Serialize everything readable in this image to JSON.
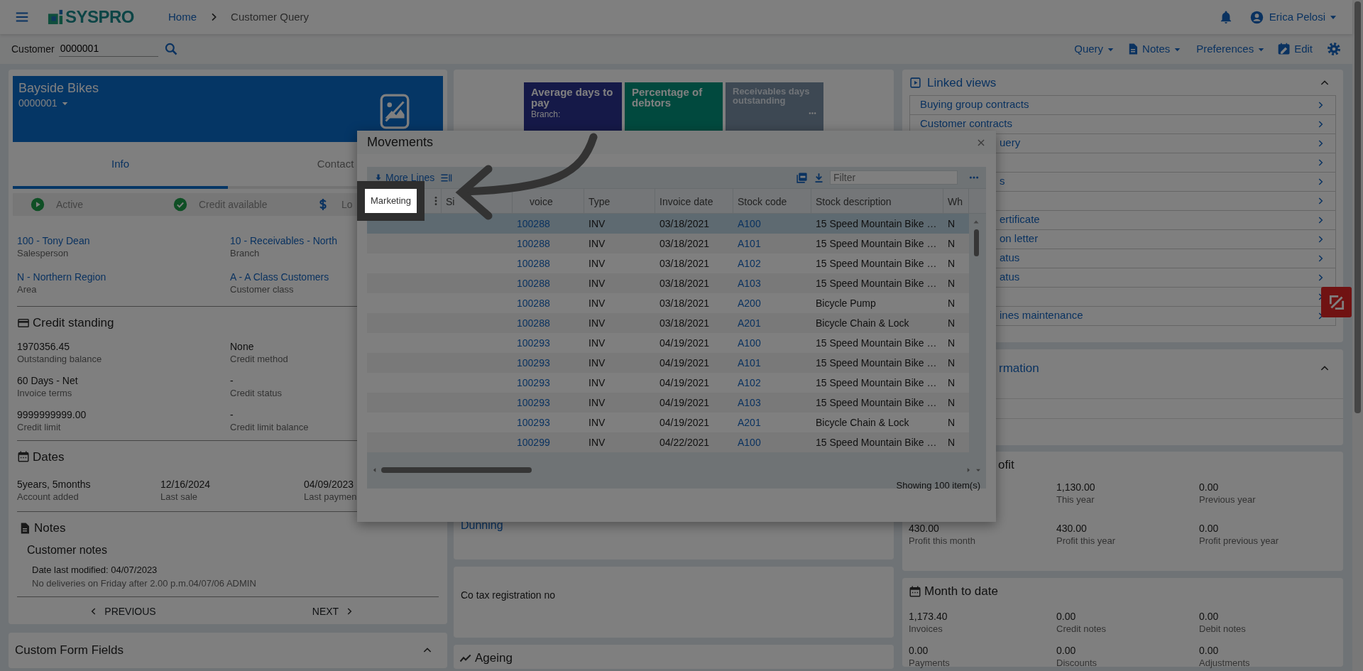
{
  "topbar": {
    "logo": "SYSPRO",
    "breadcrumbs": [
      {
        "label": "Home",
        "kind": "link"
      },
      {
        "label": "Customer Query",
        "kind": "current"
      }
    ],
    "user": "Erica Pelosi"
  },
  "customer_field": {
    "label": "Customer",
    "value": "0000001"
  },
  "actions": [
    {
      "label": "Query",
      "kind": "menu"
    },
    {
      "label": "Notes",
      "kind": "notes"
    },
    {
      "label": "Preferences",
      "kind": "menu"
    },
    {
      "label": "Edit",
      "kind": "edit"
    }
  ],
  "customer": {
    "name": "Bayside Bikes",
    "code": "0000001",
    "tabs": [
      {
        "label": "Info",
        "selected": true
      },
      {
        "label": "Contact",
        "selected": false
      }
    ],
    "status": [
      {
        "label": "Active",
        "kind": "active"
      },
      {
        "label": "Credit available",
        "kind": "credit"
      },
      {
        "label": "Lo",
        "kind": "money"
      }
    ],
    "links": [
      {
        "value": "100 - Tony Dean",
        "label": "Salesperson"
      },
      {
        "value": "10 - Receivables - North",
        "label": "Branch"
      },
      {
        "value": "N - Northern Region",
        "label": "Area"
      },
      {
        "value": "A - A Class Customers",
        "label": "Customer class"
      }
    ],
    "credit_standing": {
      "title": "Credit standing",
      "fields": [
        {
          "value": "1970356.45",
          "label": "Outstanding balance"
        },
        {
          "value": "None",
          "label": "Credit method"
        },
        {
          "value": "60 Days - Net",
          "label": "Invoice terms"
        },
        {
          "value": "-",
          "label": "Credit status"
        },
        {
          "value": "9999999999.00",
          "label": "Credit limit"
        },
        {
          "value": "-",
          "label": "Credit limit balance"
        }
      ]
    },
    "dates": {
      "title": "Dates",
      "fields": [
        {
          "value": "5years, 5months",
          "label": "Account added"
        },
        {
          "value": "12/16/2024",
          "label": "Last sale"
        },
        {
          "value": "04/09/2023",
          "label": "Last paymen"
        }
      ]
    },
    "notes": {
      "title": "Notes",
      "heading": "Customer notes",
      "modified": "Date last modified: 04/07/2023",
      "text": "No deliveries on Friday after 2.00 p.m.04/07/06 ADMIN"
    },
    "pager": {
      "previous": "PREVIOUS",
      "next": "NEXT"
    }
  },
  "custom_form_fields": {
    "title": "Custom Form Fields",
    "expanded": true
  },
  "kpis": [
    {
      "title": "Average days to pay",
      "subtitle": "Branch:",
      "kind": "navy",
      "more": false
    },
    {
      "title": "Percentage of debtors",
      "kind": "teal",
      "more": false
    },
    {
      "title": "Receivables days outstanding",
      "kind": "muted",
      "more": true
    }
  ],
  "dunning": "Dunning",
  "tax_registration": "Co tax registration no",
  "ageing": "Ageing",
  "linked_views": {
    "title": "Linked views",
    "expanded": true,
    "items": [
      {
        "kind": "link",
        "label": "Buying group contracts",
        "clipped": false
      },
      {
        "kind": "link",
        "label": "Customer contracts",
        "clipped": false
      },
      {
        "kind": "link",
        "label": "uery",
        "clipped": true
      },
      {
        "kind": "chevron-only"
      },
      {
        "kind": "link",
        "label": "s",
        "clipped": true
      },
      {
        "kind": "chevron-only"
      },
      {
        "kind": "link",
        "label": "ertificate",
        "clipped": true
      },
      {
        "kind": "link",
        "label": "on letter",
        "clipped": true
      },
      {
        "kind": "link",
        "label": "atus",
        "clipped": true
      },
      {
        "kind": "link",
        "label": "atus",
        "clipped": true
      },
      {
        "kind": "chevron-only"
      },
      {
        "kind": "link",
        "label": "ines maintenance",
        "clipped": true
      }
    ]
  },
  "customer_information": {
    "title": "rmation",
    "clipped": true,
    "expanded": true
  },
  "profit": {
    "title": "ofit",
    "clipped": true,
    "rows": [
      [
        null,
        {
          "value": "1,130.00",
          "label": "This year"
        },
        {
          "value": "0.00",
          "label": "Previous year"
        }
      ],
      [
        {
          "value": "430.00",
          "label": "Profit this month"
        },
        {
          "value": "430.00",
          "label": "Profit this year"
        },
        {
          "value": "0.00",
          "label": "Profit previous year"
        }
      ]
    ]
  },
  "month_to_date": {
    "title": "Month to date",
    "rows": [
      [
        {
          "value": "1,173.40",
          "label": "Invoices"
        },
        {
          "value": "0.00",
          "label": "Credit notes"
        },
        {
          "value": "0.00",
          "label": "Debit notes"
        }
      ],
      [
        {
          "value": "0.00",
          "label": "Payments"
        },
        {
          "value": "0.00",
          "label": "Discounts"
        },
        {
          "value": "0.00",
          "label": "Adjustments"
        }
      ]
    ]
  },
  "movements": {
    "title": "Movements",
    "more_lines": "More Lines",
    "filter_placeholder": "Filter",
    "columns": [
      {
        "label": "Marketing",
        "highlighted": true
      },
      {
        "label": "Si",
        "highlighted": false
      },
      {
        "label": "voice",
        "highlighted": false
      },
      {
        "label": "Type",
        "highlighted": false
      },
      {
        "label": "Invoice date",
        "highlighted": false
      },
      {
        "label": "Stock code",
        "highlighted": false
      },
      {
        "label": "Stock description",
        "highlighted": false
      },
      {
        "label": "Wh",
        "highlighted": false
      }
    ],
    "rows": [
      {
        "selected": true,
        "cells": [
          "",
          "",
          "100288",
          "INV",
          "03/18/2021",
          "A100",
          "15 Speed Mountain Bike …",
          "N"
        ]
      },
      {
        "selected": false,
        "cells": [
          "",
          "",
          "100288",
          "INV",
          "03/18/2021",
          "A101",
          "15 Speed Mountain Bike …",
          "N"
        ]
      },
      {
        "selected": false,
        "cells": [
          "",
          "",
          "100288",
          "INV",
          "03/18/2021",
          "A102",
          "15 Speed Mountain Bike …",
          "N"
        ]
      },
      {
        "selected": false,
        "cells": [
          "",
          "",
          "100288",
          "INV",
          "03/18/2021",
          "A103",
          "15 Speed Mountain Bike …",
          "N"
        ]
      },
      {
        "selected": false,
        "cells": [
          "",
          "",
          "100288",
          "INV",
          "03/18/2021",
          "A200",
          "Bicycle Pump",
          "N"
        ]
      },
      {
        "selected": false,
        "cells": [
          "",
          "",
          "100288",
          "INV",
          "03/18/2021",
          "A201",
          "Bicycle Chain & Lock",
          "N"
        ]
      },
      {
        "selected": false,
        "cells": [
          "",
          "",
          "100293",
          "INV",
          "04/19/2021",
          "A100",
          "15 Speed Mountain Bike …",
          "N"
        ]
      },
      {
        "selected": false,
        "cells": [
          "",
          "",
          "100293",
          "INV",
          "04/19/2021",
          "A101",
          "15 Speed Mountain Bike …",
          "N"
        ]
      },
      {
        "selected": false,
        "cells": [
          "",
          "",
          "100293",
          "INV",
          "04/19/2021",
          "A102",
          "15 Speed Mountain Bike …",
          "N"
        ]
      },
      {
        "selected": false,
        "cells": [
          "",
          "",
          "100293",
          "INV",
          "04/19/2021",
          "A103",
          "15 Speed Mountain Bike …",
          "N"
        ]
      },
      {
        "selected": false,
        "cells": [
          "",
          "",
          "100293",
          "INV",
          "04/19/2021",
          "A201",
          "Bicycle Chain & Lock",
          "N"
        ]
      },
      {
        "selected": false,
        "cells": [
          "",
          "",
          "100299",
          "INV",
          "04/22/2021",
          "A100",
          "15 Speed Mountain Bike …",
          "N"
        ]
      }
    ],
    "footer": "Showing 100 item(s)"
  }
}
